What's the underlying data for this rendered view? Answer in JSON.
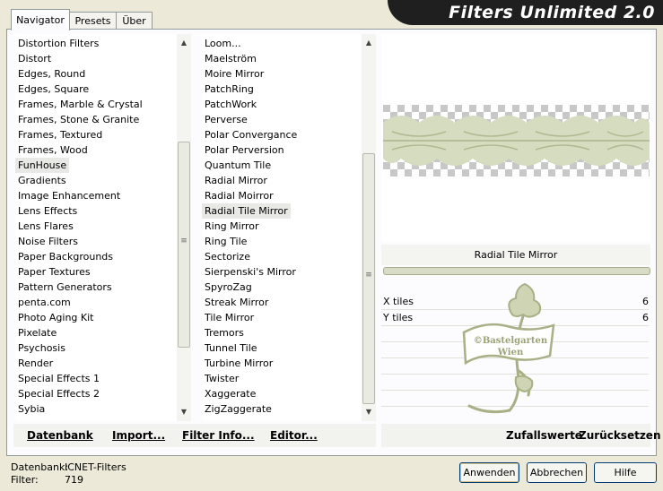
{
  "title": "Filters Unlimited 2.0",
  "tabs": [
    "Navigator",
    "Presets",
    "Über"
  ],
  "categories": {
    "items": [
      "Distortion Filters",
      "Distort",
      "Edges, Round",
      "Edges, Square",
      "Frames, Marble & Crystal",
      "Frames, Stone & Granite",
      "Frames, Textured",
      "Frames, Wood",
      "FunHouse",
      "Gradients",
      "Image Enhancement",
      "Lens Effects",
      "Lens Flares",
      "Noise Filters",
      "Paper Backgrounds",
      "Paper Textures",
      "Pattern Generators",
      "penta.com",
      "Photo Aging Kit",
      "Pixelate",
      "Psychosis",
      "Render",
      "Special Effects 1",
      "Special Effects 2",
      "Sybia"
    ],
    "selected": "FunHouse"
  },
  "filters": {
    "items": [
      "Loom...",
      "Maelström",
      "Moire Mirror",
      "PatchRing",
      "PatchWork",
      "Perverse",
      "Polar Convergance",
      "Polar Perversion",
      "Quantum Tile",
      "Radial Mirror",
      "Radial Moirror",
      "Radial Tile Mirror",
      "Ring Mirror",
      "Ring Tile",
      "Sectorize",
      "Sierpenski's Mirror",
      "SpyroZag",
      "Streak Mirror",
      "Tile Mirror",
      "Tremors",
      "Tunnel Tile",
      "Turbine Mirror",
      "Twister",
      "Xaggerate",
      "ZigZaggerate"
    ],
    "selected": "Radial Tile Mirror"
  },
  "left_buttons": [
    "Datenbank",
    "Import...",
    "Filter Info...",
    "Editor..."
  ],
  "filter_name": "Radial Tile Mirror",
  "params": [
    {
      "label": "X tiles",
      "value": "6"
    },
    {
      "label": "Y tiles",
      "value": "6"
    }
  ],
  "watermark": "©Bastelgarten Wien",
  "right_buttons": [
    "Zufallswerte",
    "Zurücksetzen"
  ],
  "status": {
    "db_label": "Datenbank:",
    "db_value": "ICNET-Filters",
    "filter_label": "Filter:",
    "filter_value": "719"
  },
  "dialog_buttons": [
    "Anwenden",
    "Abbrechen",
    "Hilfe"
  ],
  "colors": {
    "accent": "#a8b086",
    "banner": "#1f1f1f"
  }
}
